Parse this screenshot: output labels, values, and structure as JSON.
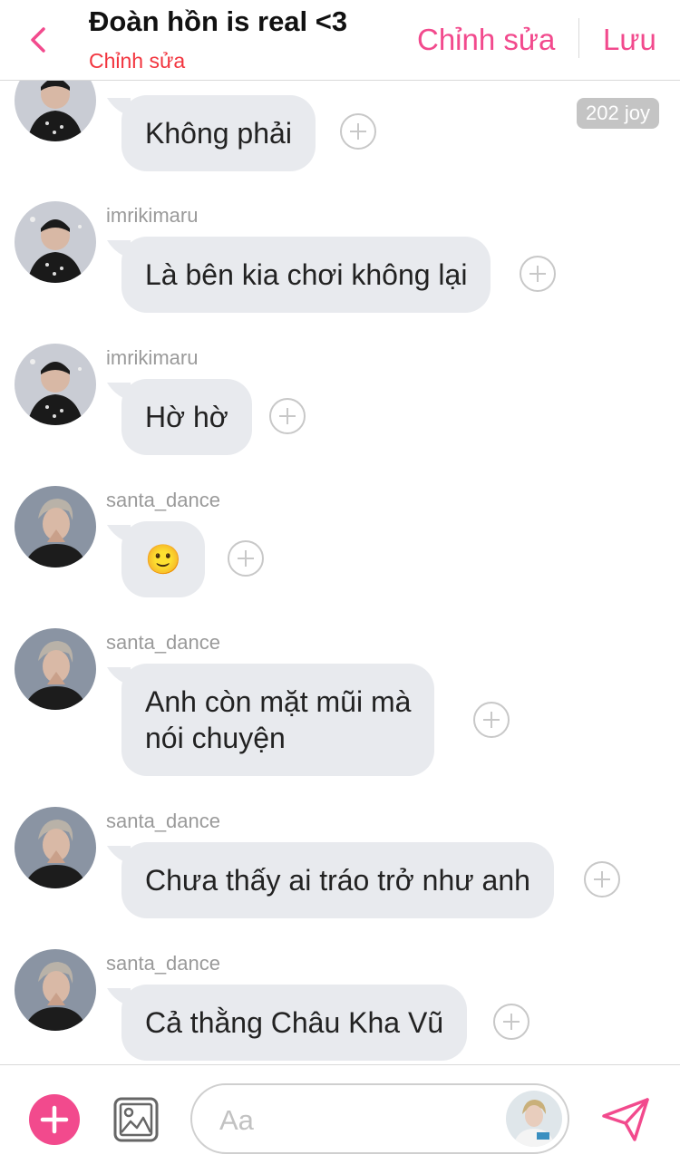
{
  "header": {
    "title": "Đoàn hồn is real <3",
    "subtitle": "Chỉnh sửa",
    "edit_label": "Chỉnh sửa",
    "save_label": "Lưu"
  },
  "joy_badge": "202 joy",
  "messages": [
    {
      "username": "",
      "text": "Không phải",
      "avatar": "avatar-imrikimaru"
    },
    {
      "username": "imrikimaru",
      "text": "Là bên kia chơi không lại",
      "avatar": "avatar-imrikimaru"
    },
    {
      "username": "imrikimaru",
      "text": "Hờ hờ",
      "avatar": "avatar-imrikimaru"
    },
    {
      "username": "santa_dance",
      "text": "🙂",
      "avatar": "avatar-santa-dance"
    },
    {
      "username": "santa_dance",
      "text_line1": "Anh còn mặt mũi mà",
      "text_line2": "nói chuyện",
      "avatar": "avatar-santa-dance"
    },
    {
      "username": "santa_dance",
      "text": "Chưa thấy ai tráo trở như anh",
      "avatar": "avatar-santa-dance"
    },
    {
      "username": "santa_dance",
      "text": "Cả thằng Châu Kha Vũ",
      "avatar": "avatar-santa-dance"
    }
  ],
  "composer": {
    "placeholder": "Aa"
  },
  "icons": {
    "back": "chevron-left-icon",
    "add": "plus-icon",
    "image": "image-icon",
    "send": "send-icon",
    "react": "add-reaction-icon"
  },
  "colors": {
    "accent": "#f24a8d",
    "subtitle": "#f2343e",
    "bubble": "#e8eaee",
    "username": "#9a9a9a"
  }
}
